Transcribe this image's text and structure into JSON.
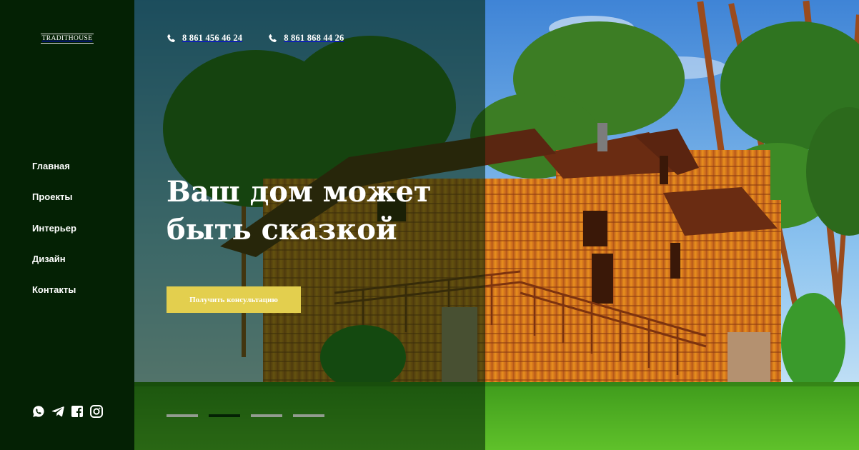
{
  "brand": {
    "logo_text": "TRADITHOUSE"
  },
  "nav": {
    "items": [
      {
        "label": "Главная"
      },
      {
        "label": "Проекты"
      },
      {
        "label": "Интерьер"
      },
      {
        "label": "Дизайн"
      },
      {
        "label": "Контакты"
      }
    ]
  },
  "contacts": {
    "phones": [
      {
        "number": "8 861 456 46 24"
      },
      {
        "number": "8 861 868 44 26"
      }
    ]
  },
  "hero": {
    "headline_line1": "Ваш дом может",
    "headline_line2": "быть сказкой",
    "cta_label": "Получить консультацию",
    "slides": {
      "count": 4,
      "active_index": 1
    }
  },
  "socials": [
    "whatsapp-icon",
    "telegram-icon",
    "facebook-icon",
    "instagram-icon"
  ],
  "colors": {
    "sidebar": "#042104",
    "accent": "#e3cf4e",
    "overlay": "rgba(3,38,5,0.58)"
  }
}
